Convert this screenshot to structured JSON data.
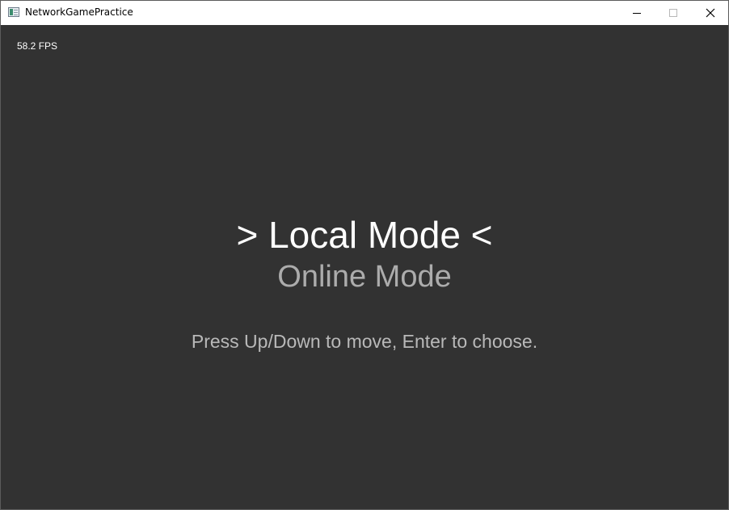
{
  "window": {
    "title": "NetworkGamePractice",
    "icon": "app-window-icon",
    "controls": [
      "minimize-icon",
      "maximize-icon",
      "close-icon"
    ]
  },
  "hud": {
    "fps": "58.2 FPS"
  },
  "menu": {
    "selected_label": "> Local Mode <",
    "options": [
      {
        "label": "Online Mode"
      }
    ],
    "hint": "Press Up/Down to move, Enter to choose."
  },
  "colors": {
    "background": "#323232",
    "selected_text": "#ffffff",
    "unselected_text": "#acacac",
    "hint_text": "#b9b9b9"
  }
}
